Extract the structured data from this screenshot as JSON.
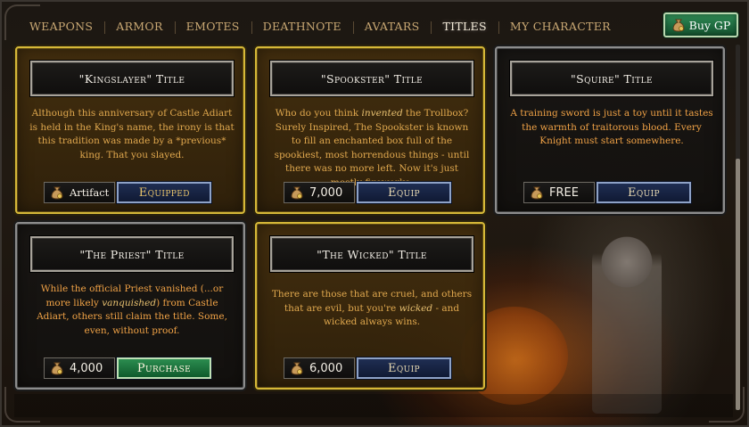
{
  "nav": {
    "tabs": [
      {
        "label": "WEAPONS",
        "active": false
      },
      {
        "label": "ARMOR",
        "active": false
      },
      {
        "label": "EMOTES",
        "active": false
      },
      {
        "label": "DEATHNOTE",
        "active": false
      },
      {
        "label": "AVATARS",
        "active": false
      },
      {
        "label": "TITLES",
        "active": true
      },
      {
        "label": "MY CHARACTER",
        "active": false
      }
    ],
    "buy_gp": {
      "label": "Buy GP",
      "icon": "coin-bag-icon"
    }
  },
  "cards": [
    {
      "title": "\"Kingslayer\" Title",
      "description_parts": [
        "Although this anniversary of Castle Adiart is held in the King's name, the irony is that this tradition was made by a *previous* king. That you slayed."
      ],
      "price": "Artifact",
      "price_icon": "coin-bag-icon",
      "button": "Equipped",
      "style": "gold"
    },
    {
      "title": "\"Spookster\" Title",
      "description_parts": [
        "Who do you think ",
        "invented",
        " the Trollbox? Surely Inspired, The Spookster is known to fill an enchanted box full of the spookiest, most horrendous things - until there was no more left. Now it's just mostly fireworks."
      ],
      "price": "7,000",
      "price_icon": "coin-bag-icon",
      "button": "Equip",
      "style": "gold"
    },
    {
      "title": "\"Squire\" Title",
      "description_parts": [
        "A training sword is just a toy until it tastes the warmth of traitorous blood. Every Knight must start somewhere."
      ],
      "price": "FREE",
      "price_icon": "coin-bag-icon",
      "button": "Equip",
      "style": "plain"
    },
    {
      "title": "\"The Priest\" Title",
      "description_parts": [
        "While the official Priest vanished (...or more likely ",
        "vanquished",
        ") from Castle Adiart, others still claim the title. Some, even, without proof."
      ],
      "price": "4,000",
      "price_icon": "coin-bag-icon",
      "button": "Purchase",
      "style": "plain"
    },
    {
      "title": "\"The Wicked\" Title",
      "description_parts": [
        "There are those that are cruel, and others that are evil, but you're ",
        "wicked",
        " - and wicked always wins."
      ],
      "price": "6,000",
      "price_icon": "coin-bag-icon",
      "button": "Equip",
      "style": "gold"
    }
  ],
  "colors": {
    "gold_border": "#d6b838",
    "plain_border": "#8d8d8d",
    "button_blue": "#1f2e52",
    "button_green": "#2b8c4f",
    "description_text": "#e0a84e"
  }
}
